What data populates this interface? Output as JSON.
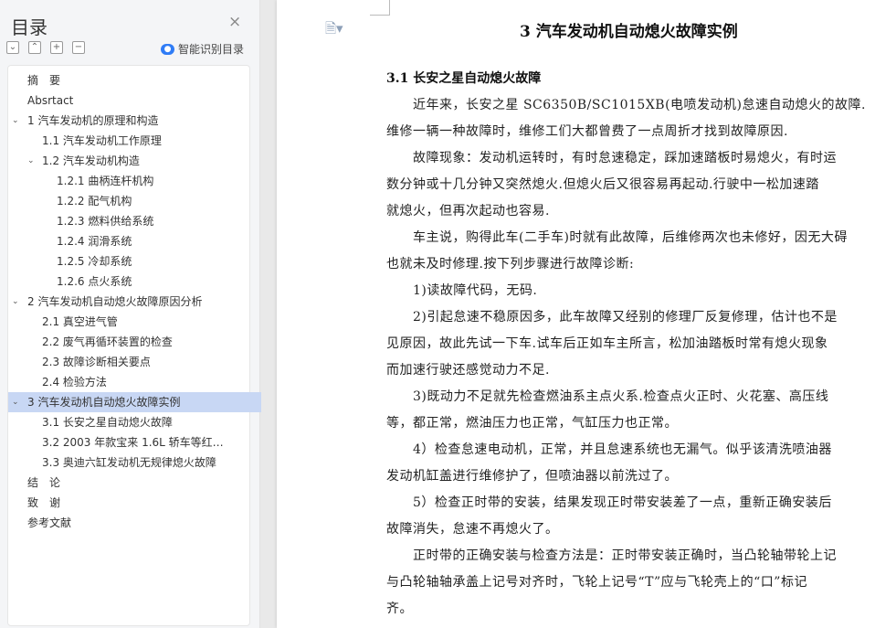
{
  "sidebar": {
    "title": "目录",
    "close": "×",
    "tools": [
      "⌄",
      "⌃",
      "+",
      "−"
    ],
    "smart_label": "智能识别目录",
    "toc": [
      {
        "label": "摘　要"
      },
      {
        "label": "Absrtact"
      },
      {
        "label": "1 汽车发动机的原理和构造"
      },
      {
        "label": "1.1 汽车发动机工作原理"
      },
      {
        "label": "1.2 汽车发动机构造"
      },
      {
        "label": "1.2.1 曲柄连杆机构"
      },
      {
        "label": "1.2.2 配气机构"
      },
      {
        "label": "1.2.3 燃料供给系统"
      },
      {
        "label": "1.2.4 润滑系统"
      },
      {
        "label": "1.2.5 冷却系统"
      },
      {
        "label": "1.2.6 点火系统"
      },
      {
        "label": "2 汽车发动机自动熄火故障原因分析"
      },
      {
        "label": "2.1 真空进气管"
      },
      {
        "label": "2.2 废气再循环装置的检查"
      },
      {
        "label": "2.3 故障诊断相关要点"
      },
      {
        "label": "2.4 检验方法"
      },
      {
        "label": "3 汽车发动机自动熄火故障实例"
      },
      {
        "label": "3.1 长安之星自动熄火故障"
      },
      {
        "label": "3.2 2003 年款宝来 1.6L 轿车等红灯熄火..."
      },
      {
        "label": "3.3 奥迪六缸发动机无规律熄火故障"
      },
      {
        "label": "结　论"
      },
      {
        "label": "致　谢"
      },
      {
        "label": "参考文献"
      }
    ]
  },
  "document": {
    "heading1": "3 汽车发动机自动熄火故障实例",
    "heading2": "3.1 长安之星自动熄火故障",
    "lines": [
      "　　近年来，长安之星 SC6350B/SC1015XB(电喷发动机)怠速自动熄火的故障.",
      "维修一辆一种故障时，维修工们大都曾费了一点周折才找到故障原因.",
      "　　故障现象：发动机运转时，有时怠速稳定，踩加速踏板时易熄火，有时运",
      "数分钟或十几分钟又突然熄火.但熄火后又很容易再起动.行驶中一松加速踏",
      "就熄火，但再次起动也容易.",
      "　　车主说，购得此车(二手车)时就有此故障，后维修两次也未修好，因无大碍",
      "也就未及时修理.按下列步骤进行故障诊断:",
      "　　1)读故障代码，无码.",
      "　　2)引起怠速不稳原因多，此车故障又经别的修理厂反复修理，估计也不是",
      "见原因，故此先试一下车.试车后正如车主所言，松加油踏板时常有熄火现象",
      "而加速行驶还感觉动力不足.",
      "　　3)既动力不足就先检查燃油系主点火系.检查点火正时、火花塞、高压线",
      "等，都正常，燃油压力也正常，气缸压力也正常。",
      "　　4）检查怠速电动机，正常，并且怠速系统也无漏气。似乎该清洗喷油器",
      "发动机缸盖进行维修护了，但喷油器以前洗过了。",
      "　　5）检查正时带的安装，结果发现正时带安装差了一点，重新正确安装后",
      "故障消失，怠速不再熄火了。",
      "　　正时带的正确安装与检查方法是：正时带安装正确时，当凸轮轴带轮上记",
      "与凸轮轴轴承盖上记号对齐时，飞轮上记号“T”应与飞轮壳上的“口”标记",
      "齐。"
    ]
  },
  "icons": {
    "document": "document-icon",
    "smart": "smart-recognize-icon"
  },
  "colors": {
    "active_toc": "#c8d7f4",
    "smart_icon": "#2f7cf6"
  }
}
